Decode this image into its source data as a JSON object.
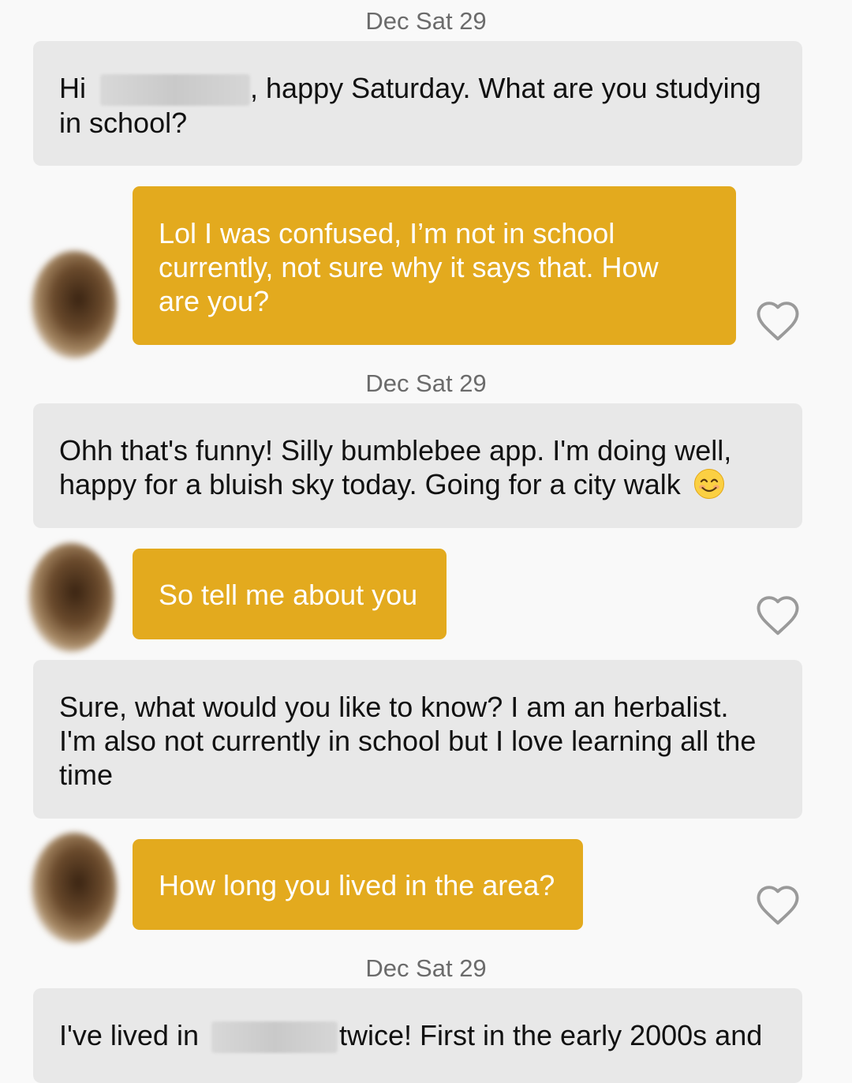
{
  "messages": [
    {
      "type": "date",
      "text": "Dec Sat 29"
    },
    {
      "type": "incoming",
      "line1_pre": "Hi",
      "line1_post": ", happy Saturday. What are you studying",
      "line2": "in school?"
    },
    {
      "type": "outgoing",
      "lines": [
        "Lol I was confused, I’m not in school",
        "currently, not sure why it says that. How",
        "are you?"
      ],
      "liked": false
    },
    {
      "type": "date",
      "text": "Dec Sat 29"
    },
    {
      "type": "incoming",
      "lines": [
        "Ohh that's funny! Silly bumblebee app. I'm doing well,",
        "happy for a bluish sky today. Going for a city walk"
      ],
      "emoji": "smiling-face"
    },
    {
      "type": "outgoing",
      "text": "So tell me about you",
      "liked": false
    },
    {
      "type": "incoming",
      "lines": [
        "Sure, what would you like to know? I am an herbalist.",
        "I'm also not currently in school but I love learning all the",
        "time"
      ]
    },
    {
      "type": "outgoing",
      "text": "How long you lived in the area?",
      "liked": false
    },
    {
      "type": "date",
      "text": "Dec Sat 29"
    },
    {
      "type": "incoming",
      "line1_pre": "I've lived in",
      "line1_post": "twice! First in the early 2000s and"
    }
  ],
  "icons": {
    "like": "heart-outline-icon",
    "emoji": "smiling-face-emoji"
  },
  "colors": {
    "outgoing_bubble": "#e3aa1e",
    "incoming_bubble": "#e8e8e8",
    "background": "#f9f9f9",
    "date_text": "#6b6b6b"
  }
}
